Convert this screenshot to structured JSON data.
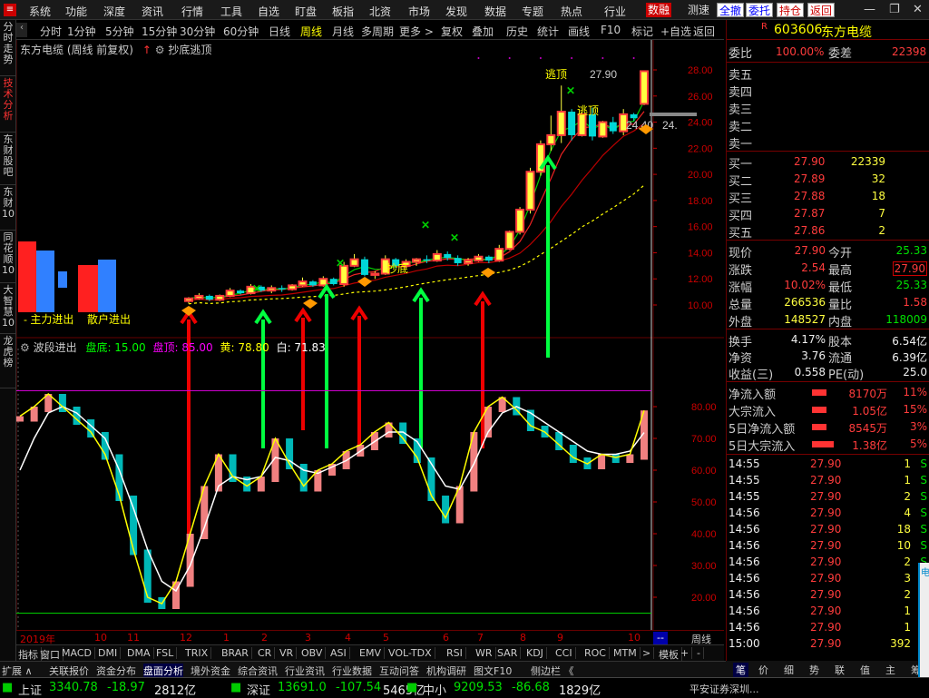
{
  "menu": [
    "系统",
    "功能",
    "深度",
    "资讯",
    "行情",
    "工具",
    "自选",
    "盯盘",
    "板指",
    "北资",
    "市场",
    "发现",
    "数据",
    "专题",
    "热点",
    "行业"
  ],
  "menu_active": "数融",
  "menu_right": [
    "测速",
    "全撤",
    "委托",
    "持仓",
    "返回"
  ],
  "left_tabs": [
    "分时走势",
    "技术分析",
    "东财股吧",
    "东财10",
    "同花顺10",
    "大智慧10",
    "龙虎榜"
  ],
  "periods": [
    "分时",
    "1分钟",
    "5分钟",
    "15分钟",
    "30分钟",
    "60分钟",
    "日线",
    "周线",
    "月线",
    "多周期",
    "更多 >"
  ],
  "period_active": "周线",
  "toolbar": [
    "复权",
    "叠加",
    "历史",
    "统计",
    "画线",
    "F10",
    "标记",
    "+自选",
    "返回"
  ],
  "chart_title": "东方电缆 (周线 前复权)",
  "indicator1": "抄底逃顶",
  "indicator2": {
    "name": "波段进出",
    "bottom": "盘底: 15.00",
    "top": "盘顶: 85.00",
    "yellow": "黄: 78.80",
    "white": "白: 71.83"
  },
  "legend": {
    "main": "主力进出",
    "retail": "散户进出"
  },
  "signal_labels": {
    "escape": "逃顶",
    "bottom": "抄底"
  },
  "annot": {
    "high": "27.90",
    "low": "24.40",
    "low_right": "24."
  },
  "chart_data": {
    "type": "candlestick",
    "price_axis": [
      28.0,
      26.0,
      24.0,
      22.0,
      20.0,
      18.0,
      16.0,
      14.0,
      12.0,
      10.0
    ],
    "osc_axis": [
      80.0,
      70.0,
      60.0,
      50.0,
      40.0,
      30.0,
      20.0
    ],
    "x_labels": [
      "2019年",
      "10",
      "11",
      "12",
      "1",
      "2",
      "3",
      "4",
      "5",
      "6",
      "7",
      "8",
      "9",
      "10"
    ],
    "period_label": "周线",
    "candles": [
      [
        10.3,
        10.6,
        10.1,
        10.5
      ],
      [
        10.5,
        10.9,
        10.4,
        10.7
      ],
      [
        10.7,
        10.8,
        10.3,
        10.4
      ],
      [
        10.4,
        10.8,
        10.3,
        10.7
      ],
      [
        10.7,
        11.3,
        10.6,
        11.1
      ],
      [
        11.1,
        11.2,
        10.8,
        10.9
      ],
      [
        10.9,
        11.6,
        10.8,
        11.4
      ],
      [
        11.4,
        11.5,
        11.0,
        11.1
      ],
      [
        11.1,
        11.5,
        10.9,
        11.3
      ],
      [
        11.3,
        11.5,
        11.0,
        11.2
      ],
      [
        11.2,
        11.6,
        11.1,
        11.5
      ],
      [
        11.5,
        12.1,
        11.4,
        11.8
      ],
      [
        11.8,
        11.9,
        11.4,
        11.5
      ],
      [
        11.5,
        12.2,
        11.4,
        12.0
      ],
      [
        12.0,
        12.1,
        11.5,
        11.6
      ],
      [
        11.6,
        13.3,
        11.4,
        13.0
      ],
      [
        13.0,
        13.9,
        12.9,
        13.5
      ],
      [
        13.5,
        13.7,
        12.2,
        12.3
      ],
      [
        12.3,
        12.6,
        12.0,
        12.4
      ],
      [
        12.4,
        13.8,
        12.3,
        13.5
      ],
      [
        13.5,
        13.6,
        12.8,
        13.0
      ],
      [
        13.0,
        13.5,
        12.8,
        13.3
      ],
      [
        13.3,
        13.6,
        13.0,
        13.5
      ],
      [
        13.5,
        13.8,
        13.2,
        13.4
      ],
      [
        13.4,
        14.2,
        13.3,
        13.9
      ],
      [
        13.9,
        14.1,
        13.4,
        13.6
      ],
      [
        13.6,
        13.8,
        13.0,
        13.2
      ],
      [
        13.2,
        13.6,
        13.0,
        13.4
      ],
      [
        13.4,
        13.9,
        13.3,
        13.7
      ],
      [
        13.7,
        13.8,
        13.2,
        13.4
      ],
      [
        13.4,
        14.6,
        13.3,
        14.3
      ],
      [
        14.3,
        15.7,
        14.2,
        15.6
      ],
      [
        15.6,
        17.5,
        15.4,
        17.3
      ],
      [
        17.3,
        20.5,
        17.0,
        20.2
      ],
      [
        20.2,
        22.6,
        19.9,
        22.3
      ],
      [
        22.3,
        24.5,
        21.8,
        23.0
      ],
      [
        23.0,
        26.8,
        22.4,
        24.8
      ],
      [
        24.8,
        25.0,
        22.6,
        23.0
      ],
      [
        23.0,
        24.8,
        22.9,
        24.6
      ],
      [
        24.6,
        25.1,
        22.6,
        22.9
      ],
      [
        22.9,
        24.1,
        22.8,
        24.0
      ],
      [
        24.0,
        24.4,
        23.1,
        23.3
      ],
      [
        23.3,
        25.0,
        23.0,
        24.6
      ],
      [
        24.6,
        24.7,
        24.1,
        24.3
      ],
      [
        25.4,
        27.9,
        25.3,
        27.9
      ]
    ],
    "series": [
      {
        "name": "黄",
        "values": [
          77,
          80,
          84,
          80,
          76,
          72,
          65,
          52,
          35,
          20,
          18,
          25,
          40,
          55,
          65,
          58,
          55,
          58,
          70,
          62,
          55,
          60,
          62,
          66,
          68,
          72,
          75,
          70,
          64,
          52,
          45,
          55,
          72,
          80,
          83,
          79,
          74,
          72,
          68,
          64,
          62,
          65,
          64,
          65,
          78.8
        ]
      },
      {
        "name": "白",
        "values": [
          60,
          70,
          78,
          80,
          78,
          74,
          70,
          60,
          48,
          35,
          25,
          22,
          30,
          42,
          55,
          58,
          57,
          58,
          64,
          63,
          60,
          59,
          61,
          63,
          66,
          69,
          72,
          72,
          69,
          62,
          55,
          54,
          62,
          72,
          78,
          80,
          78,
          75,
          72,
          69,
          66,
          65,
          65,
          66,
          71.83
        ]
      }
    ]
  },
  "stock": {
    "code": "603606",
    "name": "东方电缆",
    "weibi_label": "委比",
    "weibi": "100.00%",
    "weicha_label": "委差",
    "weicha": "22398"
  },
  "asks": [
    {
      "l": "卖五",
      "p": "",
      "v": ""
    },
    {
      "l": "卖四",
      "p": "",
      "v": ""
    },
    {
      "l": "卖三",
      "p": "",
      "v": ""
    },
    {
      "l": "卖二",
      "p": "",
      "v": ""
    },
    {
      "l": "卖一",
      "p": "",
      "v": ""
    }
  ],
  "bids": [
    {
      "l": "买一",
      "p": "27.90",
      "v": "22339"
    },
    {
      "l": "买二",
      "p": "27.89",
      "v": "32"
    },
    {
      "l": "买三",
      "p": "27.88",
      "v": "18"
    },
    {
      "l": "买四",
      "p": "27.87",
      "v": "7"
    },
    {
      "l": "买五",
      "p": "27.86",
      "v": "2"
    }
  ],
  "quote": [
    {
      "l1": "现价",
      "v1": "27.90",
      "l2": "今开",
      "v2": "25.33",
      "c2": "green"
    },
    {
      "l1": "涨跌",
      "v1": "2.54",
      "l2": "最高",
      "v2": "27.90",
      "c2": "red"
    },
    {
      "l1": "涨幅",
      "v1": "10.02%",
      "l2": "最低",
      "v2": "25.33",
      "c2": "green"
    },
    {
      "l1": "总量",
      "v1": "266536",
      "l2": "量比",
      "v2": "1.58",
      "c2": "red"
    },
    {
      "l1": "外盘",
      "v1": "148527",
      "l2": "内盘",
      "v2": "118009",
      "c2": "green"
    }
  ],
  "fund": [
    {
      "l1": "换手",
      "v1": "4.17%",
      "l2": "股本",
      "v2": "6.54亿"
    },
    {
      "l1": "净资",
      "v1": "3.76",
      "l2": "流通",
      "v2": "6.39亿"
    },
    {
      "l1": "收益(三)",
      "v1": "0.558",
      "l2": "PE(动)",
      "v2": "25.0"
    }
  ],
  "flows": [
    {
      "l": "净流入额",
      "v": "8170万",
      "p": "11%"
    },
    {
      "l": "大宗流入",
      "v": "1.05亿",
      "p": "15%"
    },
    {
      "l": "5日净流入额",
      "v": "8545万",
      "p": "3%"
    },
    {
      "l": "5日大宗流入",
      "v": "1.38亿",
      "p": "5%"
    }
  ],
  "ticks": [
    {
      "t": "14:55",
      "p": "27.90",
      "v": "1",
      "d": "S"
    },
    {
      "t": "14:55",
      "p": "27.90",
      "v": "1",
      "d": "S"
    },
    {
      "t": "14:55",
      "p": "27.90",
      "v": "2",
      "d": "S"
    },
    {
      "t": "14:56",
      "p": "27.90",
      "v": "4",
      "d": "S"
    },
    {
      "t": "14:56",
      "p": "27.90",
      "v": "18",
      "d": "S"
    },
    {
      "t": "14:56",
      "p": "27.90",
      "v": "10",
      "d": "S"
    },
    {
      "t": "14:56",
      "p": "27.90",
      "v": "2",
      "d": "S"
    },
    {
      "t": "14:56",
      "p": "27.90",
      "v": "3",
      "d": "S"
    },
    {
      "t": "14:56",
      "p": "27.90",
      "v": "2",
      "d": "S"
    },
    {
      "t": "14:56",
      "p": "27.90",
      "v": "1",
      "d": "S"
    },
    {
      "t": "14:56",
      "p": "27.90",
      "v": "1",
      "d": "S"
    },
    {
      "t": "15:00",
      "p": "27.90",
      "v": "392",
      "d": "S"
    }
  ],
  "ind_tabs": [
    "指标",
    "窗口",
    "MACD",
    "DMI",
    "DMA",
    "FSL",
    "TRIX",
    "BRAR",
    "CR",
    "VR",
    "OBV",
    "ASI",
    "EMV",
    "VOL-TDX",
    "RSI",
    "WR",
    "SAR",
    "KDJ",
    "CCI",
    "ROC",
    "MTM",
    ">",
    "模板",
    "+",
    "-"
  ],
  "bottom_tabs": [
    "扩展 ∧",
    "关联报价",
    "资金分布",
    "盘面分析",
    "境外资金",
    "综合资讯",
    "行业资讯",
    "行业数据",
    "互动问答",
    "机构调研",
    "图文F10",
    "侧边栏 《"
  ],
  "right_tabs": [
    "笔",
    "价",
    "细",
    "势",
    "联",
    "值",
    "主",
    "筹"
  ],
  "status": [
    {
      "n": "上证",
      "v": "3340.78",
      "c": "-18.97",
      "a": "2812亿"
    },
    {
      "n": "深证",
      "v": "13691.0",
      "c": "-107.54",
      "a": "5465亿"
    },
    {
      "n": "中小",
      "v": "9209.53",
      "c": "-86.68",
      "a": "1829亿"
    }
  ],
  "broker": "平安证券深圳..."
}
